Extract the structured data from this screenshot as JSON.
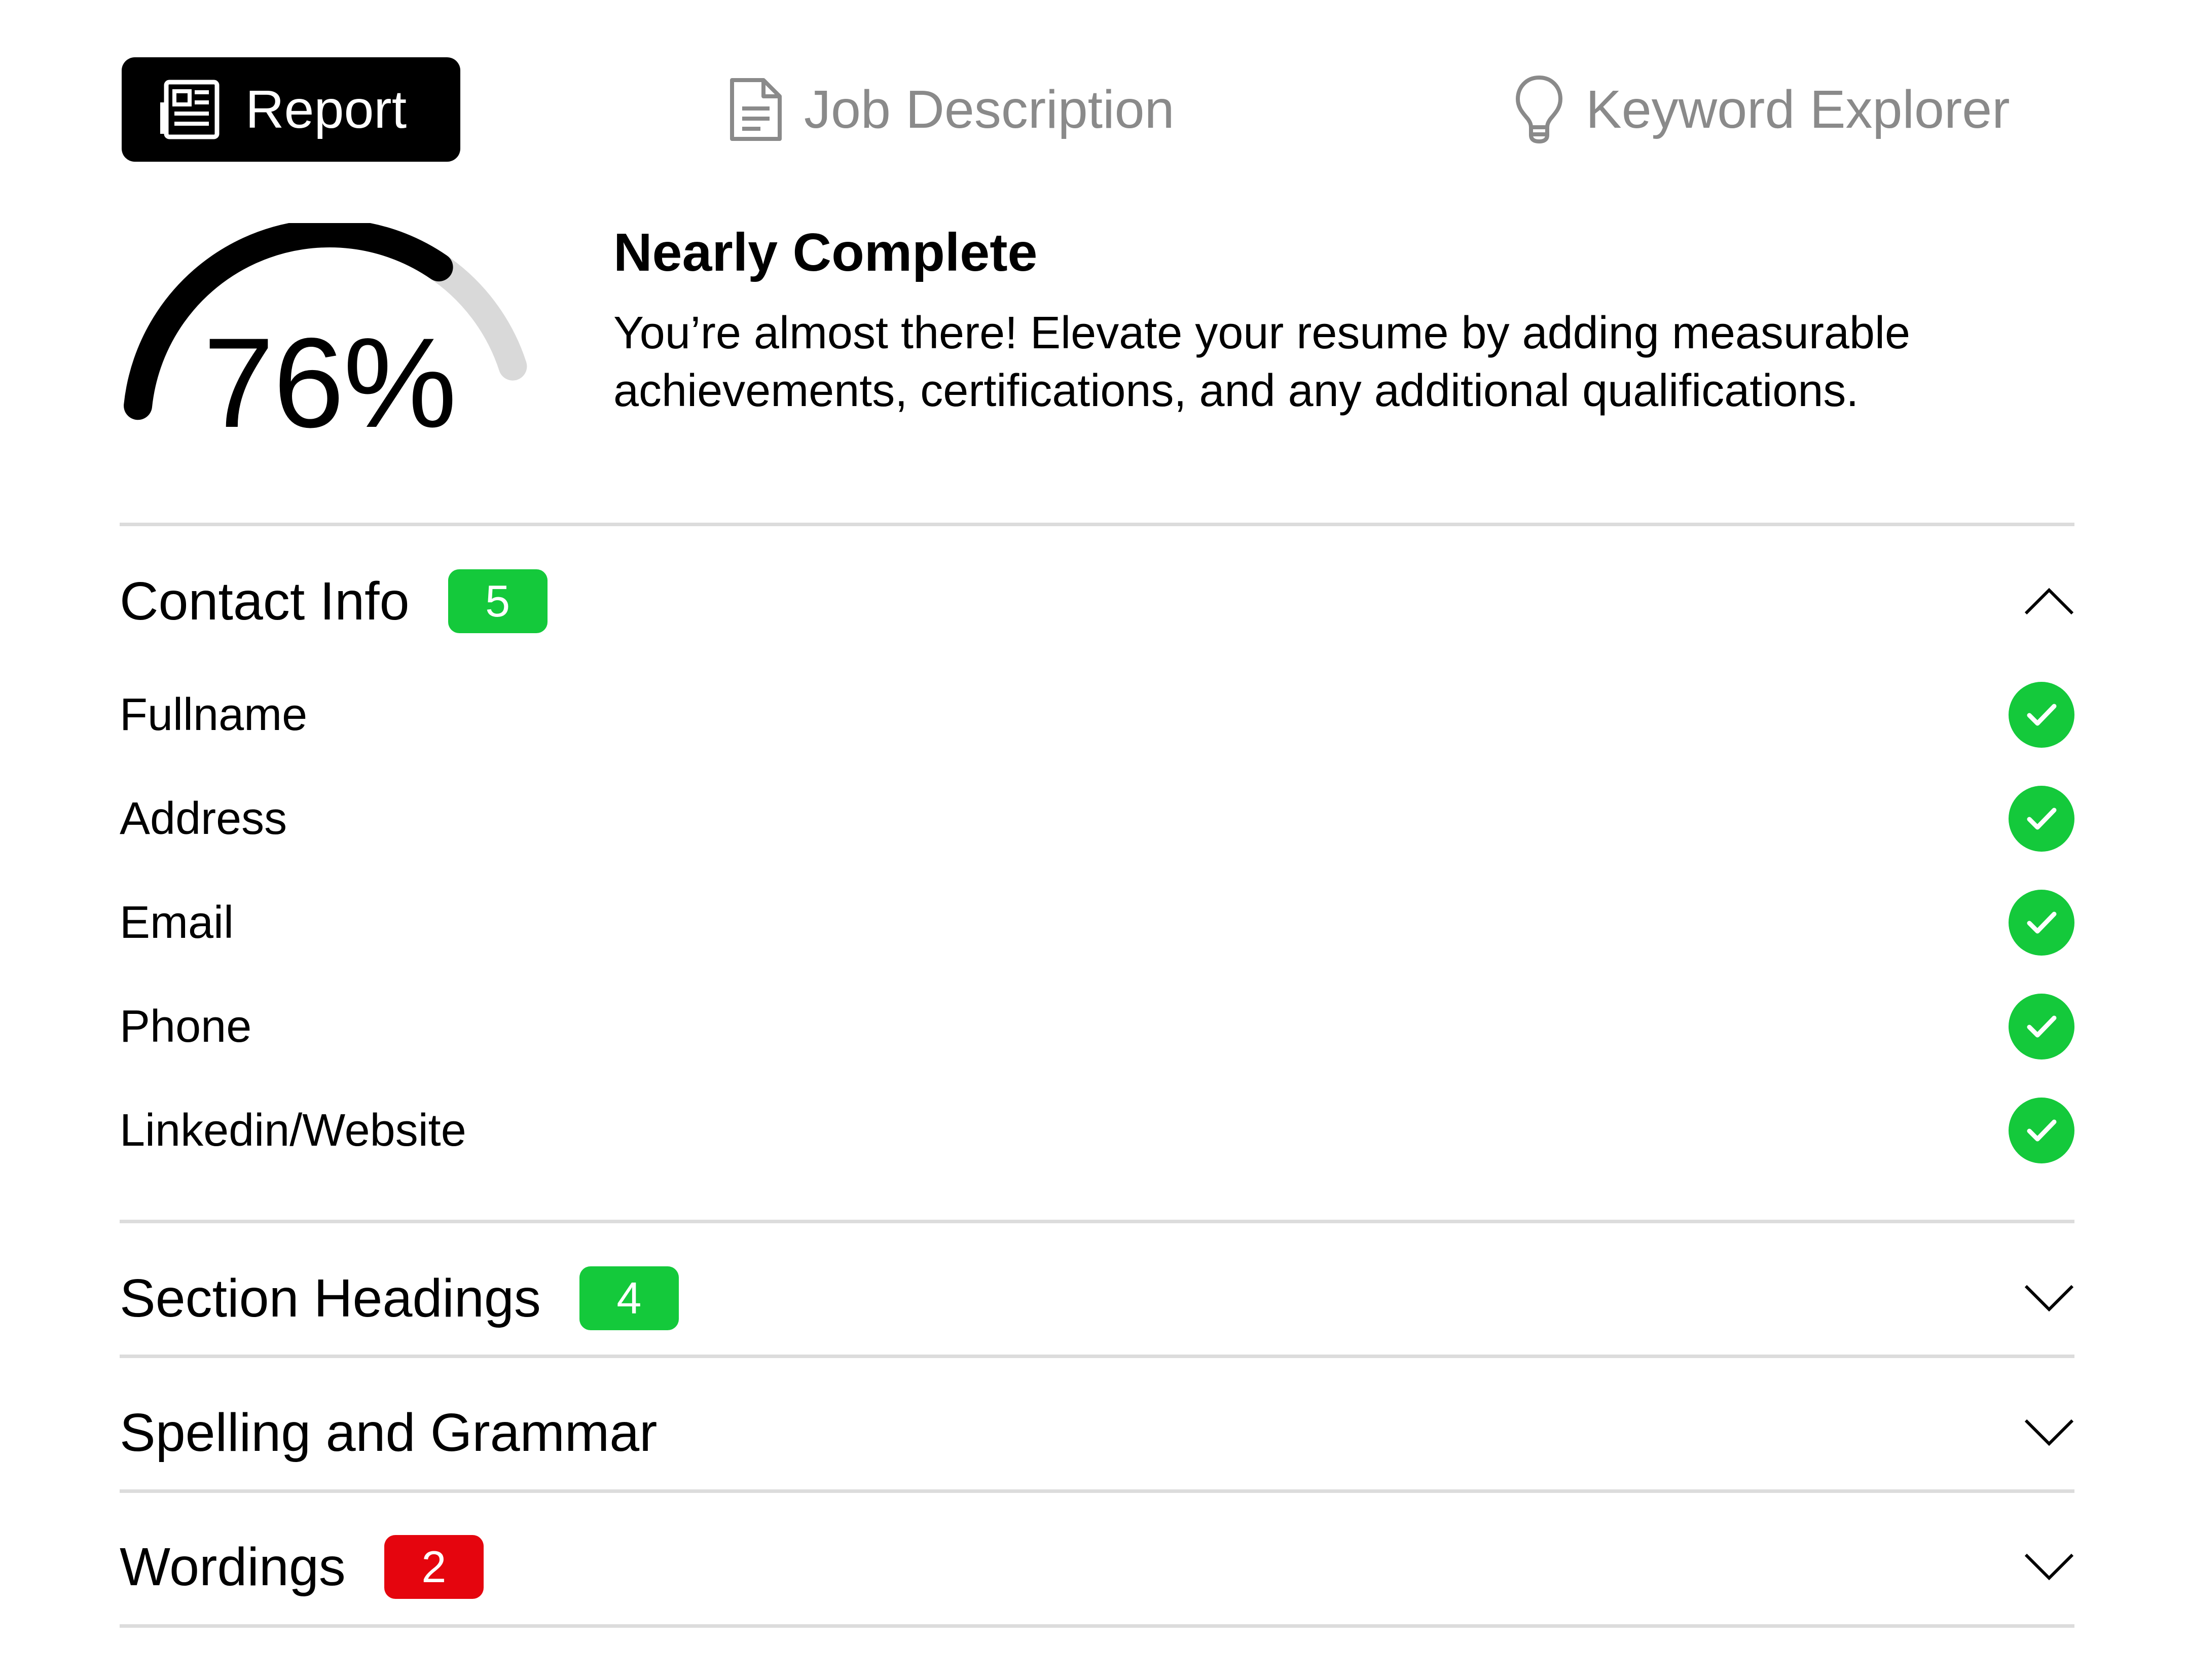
{
  "tabs": [
    {
      "label": "Report",
      "icon": "newspaper-icon",
      "active": true
    },
    {
      "label": "Job Description",
      "icon": "document-icon",
      "active": false
    },
    {
      "label": "Keyword Explorer",
      "icon": "lightbulb-icon",
      "active": false
    }
  ],
  "score": {
    "value_label": "76%",
    "fraction": 0.76,
    "title": "Nearly Complete",
    "description": "You’re almost there! Elevate your resume by adding measurable achievements, certifications, and any additional qualifications."
  },
  "sections": [
    {
      "title": "Contact Info",
      "badge": "5",
      "badge_color": "#14c93b",
      "expanded": true,
      "chevron": "chevron-up-icon",
      "items": [
        {
          "label": "Fullname",
          "status": "check-icon"
        },
        {
          "label": "Address",
          "status": "check-icon"
        },
        {
          "label": "Email",
          "status": "check-icon"
        },
        {
          "label": "Phone",
          "status": "check-icon"
        },
        {
          "label": "Linkedin/Website",
          "status": "check-icon"
        }
      ]
    },
    {
      "title": "Section Headings",
      "badge": "4",
      "badge_color": "#14c93b",
      "expanded": false,
      "chevron": "chevron-down-icon"
    },
    {
      "title": "Spelling and Grammar",
      "expanded": false,
      "chevron": "chevron-down-icon"
    },
    {
      "title": "Wordings",
      "badge": "2",
      "badge_color": "#e5050e",
      "expanded": false,
      "chevron": "chevron-down-icon"
    }
  ],
  "colors": {
    "success": "#14c93b",
    "error": "#e5050e",
    "tab_active_bg": "#000000",
    "tab_inactive_text": "#8a8a8a",
    "gauge_track": "#d9d9d9"
  }
}
